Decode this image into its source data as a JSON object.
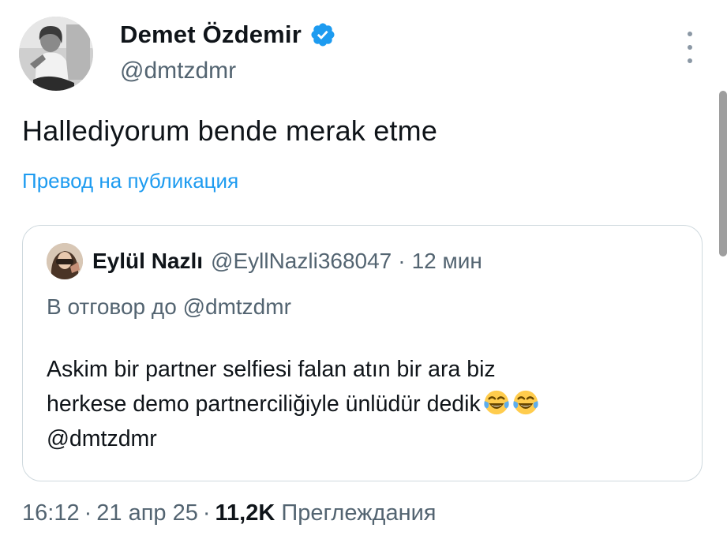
{
  "author": {
    "display_name": "Demet Özdemir",
    "handle": "@dmtzdmr",
    "verified_icon": "verified-badge-icon",
    "avatar": "avatar-photo"
  },
  "menu": {
    "icon": "more-vertical-icon"
  },
  "tweet": {
    "text": "Hallediyorum bende merak etme",
    "translate_label": "Превод на публикация"
  },
  "quote": {
    "display_name": "Eylül Nazlı",
    "handle": "@EyllNazli368047",
    "separator": "·",
    "time": "12 мин",
    "reply_to": "В отговор до @dmtzdmr",
    "body_lines": [
      "Askim bir partner selfiesi falan atın bir ara biz",
      "herkese demo partnerciliğiyle ünlüdür dedik",
      "@dmtzdmr"
    ],
    "emojis": [
      "face-with-tears-of-joy-icon",
      "face-with-tears-of-joy-icon"
    ]
  },
  "meta": {
    "time": "16:12",
    "separator": "·",
    "date": "21 апр 25",
    "views_count": "11,2K",
    "views_label": "Преглеждания"
  },
  "colors": {
    "accent": "#1d9bf0",
    "text": "#0f1419",
    "secondary": "#536471",
    "border": "#cfd9de"
  }
}
